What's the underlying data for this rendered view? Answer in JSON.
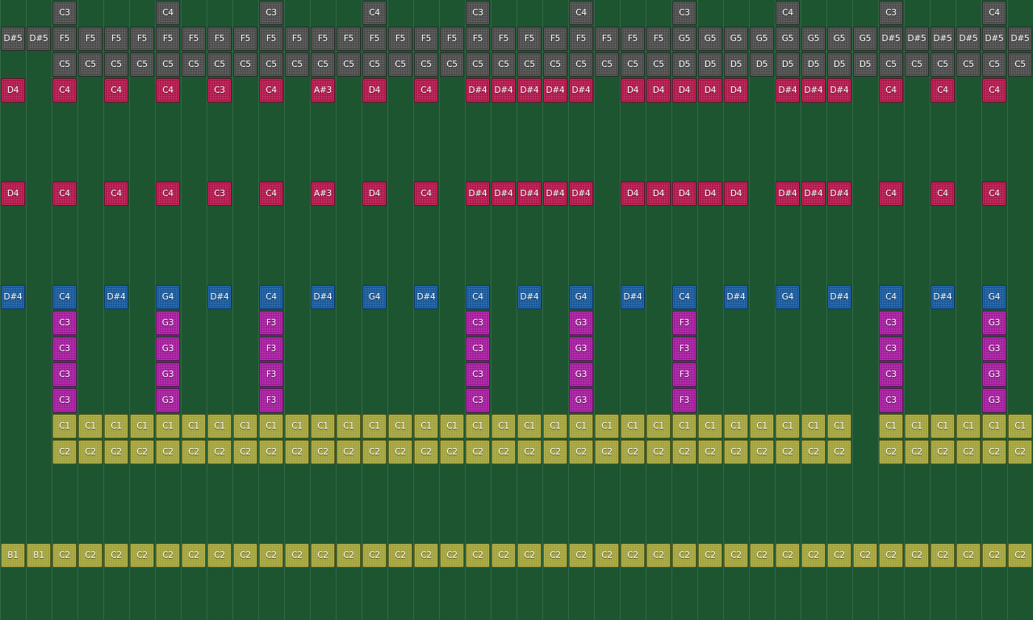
{
  "colors": {
    "background": "#1c5530",
    "gray": "#4a4a4a",
    "crimson": "#b0154a",
    "blue": "#15579a",
    "magenta": "#a3199c",
    "olive": "#a2a23a"
  },
  "rows": [
    {
      "color": "gray",
      "notes": [
        null,
        null,
        "C3",
        null,
        null,
        null,
        "C4",
        null,
        null,
        null,
        "C3",
        null,
        null,
        null,
        "C4",
        null,
        null,
        null,
        "C3",
        null,
        null,
        null,
        "C4",
        null,
        null,
        null,
        "C3",
        null,
        null,
        null,
        "C4",
        null,
        null,
        null,
        "C3",
        null,
        null,
        null,
        "C4",
        null
      ]
    },
    {
      "color": "gray",
      "notes": [
        "D#5",
        "D#5",
        "F5",
        "F5",
        "F5",
        "F5",
        "F5",
        "F5",
        "F5",
        "F5",
        "F5",
        "F5",
        "F5",
        "F5",
        "F5",
        "F5",
        "F5",
        "F5",
        "F5",
        "F5",
        "F5",
        "F5",
        "F5",
        "F5",
        "F5",
        "F5",
        "G5",
        "G5",
        "G5",
        "G5",
        "G5",
        "G5",
        "G5",
        "G5",
        "D#5",
        "D#5",
        "D#5",
        "D#5",
        "D#5",
        "D#5"
      ]
    },
    {
      "color": "gray",
      "notes": [
        null,
        null,
        "C5",
        "C5",
        "C5",
        "C5",
        "C5",
        "C5",
        "C5",
        "C5",
        "C5",
        "C5",
        "C5",
        "C5",
        "C5",
        "C5",
        "C5",
        "C5",
        "C5",
        "C5",
        "C5",
        "C5",
        "C5",
        "C5",
        "C5",
        "C5",
        "D5",
        "D5",
        "D5",
        "D5",
        "D5",
        "D5",
        "D5",
        "D5",
        "C5",
        "C5",
        "C5",
        "C5",
        "C5",
        "C5"
      ]
    },
    {
      "color": "crimson",
      "notes": [
        "D4",
        null,
        "C4",
        null,
        "C4",
        null,
        "C4",
        null,
        "C3",
        null,
        "C4",
        null,
        "A#3",
        null,
        "D4",
        null,
        "C4",
        null,
        "D#4",
        "D#4",
        "D#4",
        "D#4",
        "D#4",
        null,
        "D4",
        "D4",
        "D4",
        "D4",
        "D4",
        null,
        "D#4",
        "D#4",
        "D#4",
        null,
        "C4",
        null,
        "C4",
        null,
        "C4",
        null
      ]
    },
    {
      "color": "crimson",
      "notes": []
    },
    {
      "color": "crimson",
      "notes": []
    },
    {
      "color": "crimson",
      "notes": []
    },
    {
      "color": "crimson",
      "notes": [
        "D4",
        null,
        "C4",
        null,
        "C4",
        null,
        "C4",
        null,
        "C3",
        null,
        "C4",
        null,
        "A#3",
        null,
        "D4",
        null,
        "C4",
        null,
        "D#4",
        "D#4",
        "D#4",
        "D#4",
        "D#4",
        null,
        "D4",
        "D4",
        "D4",
        "D4",
        "D4",
        null,
        "D#4",
        "D#4",
        "D#4",
        null,
        "C4",
        null,
        "C4",
        null,
        "C4",
        null
      ]
    },
    {
      "color": "blue",
      "notes": []
    },
    {
      "color": "blue",
      "notes": []
    },
    {
      "color": "blue",
      "notes": []
    },
    {
      "color": "blue",
      "notes": [
        "D#4",
        null,
        "C4",
        null,
        "D#4",
        null,
        "G4",
        null,
        "D#4",
        null,
        "C4",
        null,
        "D#4",
        null,
        "G4",
        null,
        "D#4",
        null,
        "C4",
        null,
        "D#4",
        null,
        "G4",
        null,
        "D#4",
        null,
        "C4",
        null,
        "D#4",
        null,
        "G4",
        null,
        "D#4",
        null,
        "C4",
        null,
        "D#4",
        null,
        "G4",
        null
      ]
    },
    {
      "color": "magenta",
      "notes": [
        null,
        null,
        "C3",
        null,
        null,
        null,
        "G3",
        null,
        null,
        null,
        "F3",
        null,
        null,
        null,
        null,
        null,
        null,
        null,
        "C3",
        null,
        null,
        null,
        "G3",
        null,
        null,
        null,
        "F3",
        null,
        null,
        null,
        null,
        null,
        null,
        null,
        "C3",
        null,
        null,
        null,
        "G3",
        null
      ]
    },
    {
      "color": "magenta",
      "notes": [
        null,
        null,
        "C3",
        null,
        null,
        null,
        "G3",
        null,
        null,
        null,
        "F3",
        null,
        null,
        null,
        null,
        null,
        null,
        null,
        "C3",
        null,
        null,
        null,
        "G3",
        null,
        null,
        null,
        "F3",
        null,
        null,
        null,
        null,
        null,
        null,
        null,
        "C3",
        null,
        null,
        null,
        "G3",
        null
      ]
    },
    {
      "color": "magenta",
      "notes": [
        null,
        null,
        "C3",
        null,
        null,
        null,
        "G3",
        null,
        null,
        null,
        "F3",
        null,
        null,
        null,
        null,
        null,
        null,
        null,
        "C3",
        null,
        null,
        null,
        "G3",
        null,
        null,
        null,
        "F3",
        null,
        null,
        null,
        null,
        null,
        null,
        null,
        "C3",
        null,
        null,
        null,
        "G3",
        null
      ]
    },
    {
      "color": "magenta",
      "notes": [
        null,
        null,
        "C3",
        null,
        null,
        null,
        "G3",
        null,
        null,
        null,
        "F3",
        null,
        null,
        null,
        null,
        null,
        null,
        null,
        "C3",
        null,
        null,
        null,
        "G3",
        null,
        null,
        null,
        "F3",
        null,
        null,
        null,
        null,
        null,
        null,
        null,
        "C3",
        null,
        null,
        null,
        "G3",
        null
      ]
    },
    {
      "color": "olive",
      "notes": [
        null,
        null,
        "C1",
        "C1",
        "C1",
        "C1",
        "C1",
        "C1",
        "C1",
        "C1",
        "C1",
        "C1",
        "C1",
        "C1",
        "C1",
        "C1",
        "C1",
        "C1",
        "C1",
        "C1",
        "C1",
        "C1",
        "C1",
        "C1",
        "C1",
        "C1",
        "C1",
        "C1",
        "C1",
        "C1",
        "C1",
        "C1",
        "C1",
        null,
        "C1",
        "C1",
        "C1",
        "C1",
        "C1",
        "C1"
      ]
    },
    {
      "color": "olive",
      "notes": [
        null,
        null,
        "C2",
        "C2",
        "C2",
        "C2",
        "C2",
        "C2",
        "C2",
        "C2",
        "C2",
        "C2",
        "C2",
        "C2",
        "C2",
        "C2",
        "C2",
        "C2",
        "C2",
        "C2",
        "C2",
        "C2",
        "C2",
        "C2",
        "C2",
        "C2",
        "C2",
        "C2",
        "C2",
        "C2",
        "C2",
        "C2",
        "C2",
        null,
        "C2",
        "C2",
        "C2",
        "C2",
        "C2",
        "C2"
      ]
    },
    {
      "color": "olive",
      "notes": []
    },
    {
      "color": "olive",
      "notes": []
    },
    {
      "color": "olive",
      "notes": []
    },
    {
      "color": "olive",
      "notes": [
        "B1",
        "B1",
        "C2",
        "C2",
        "C2",
        "C2",
        "C2",
        "C2",
        "C2",
        "C2",
        "C2",
        "C2",
        "C2",
        "C2",
        "C2",
        "C2",
        "C2",
        "C2",
        "C2",
        "C2",
        "C2",
        "C2",
        "C2",
        "C2",
        "C2",
        "C2",
        "C2",
        "C2",
        "C2",
        "C2",
        "C2",
        "C2",
        "C2",
        "C2",
        "C2",
        "C2",
        "C2",
        "C2",
        "C2",
        "C2"
      ]
    }
  ]
}
